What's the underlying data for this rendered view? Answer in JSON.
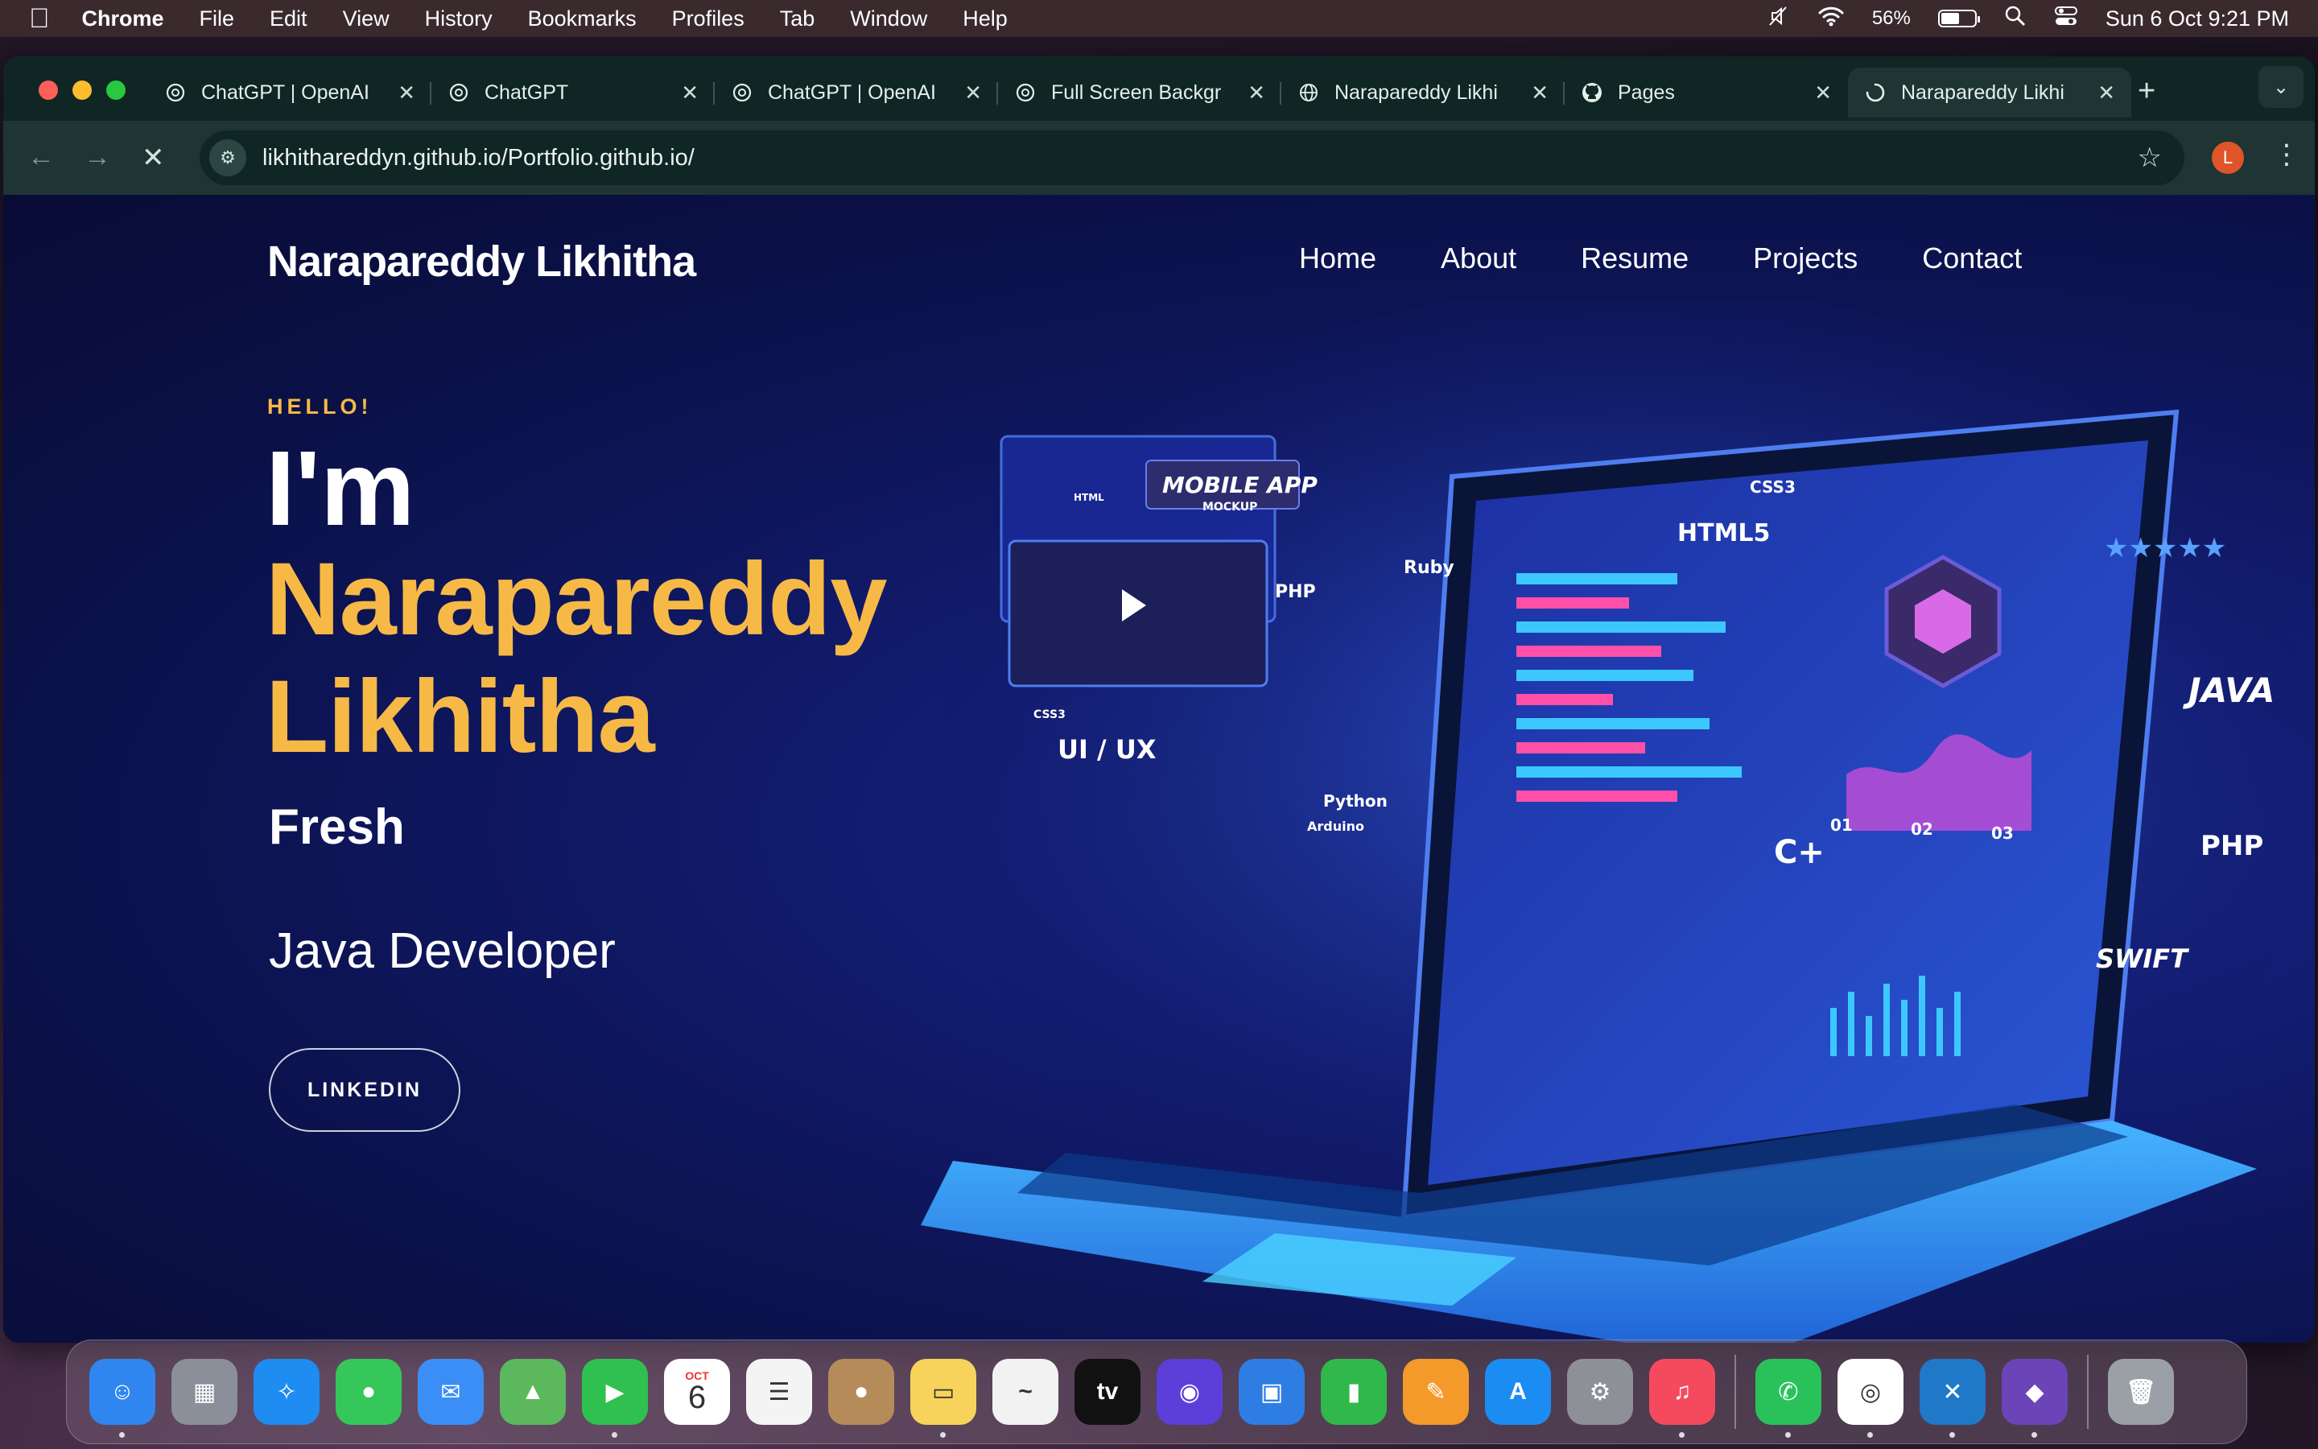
{
  "menubar": {
    "app": "Chrome",
    "items": [
      "File",
      "Edit",
      "View",
      "History",
      "Bookmarks",
      "Profiles",
      "Tab",
      "Window",
      "Help"
    ],
    "battery_pct": "56%",
    "battery_level": 0.56,
    "datetime": "Sun 6 Oct  9:21 PM"
  },
  "tabs": [
    {
      "title": "ChatGPT | OpenAI",
      "icon": "openai-icon",
      "active": false
    },
    {
      "title": "ChatGPT",
      "icon": "openai-icon",
      "active": false
    },
    {
      "title": "ChatGPT | OpenAI",
      "icon": "openai-icon",
      "active": false
    },
    {
      "title": "Full Screen Backgr",
      "icon": "openai-icon",
      "active": false
    },
    {
      "title": "Narapareddy Likhi",
      "icon": "globe-icon",
      "active": false
    },
    {
      "title": "Pages",
      "icon": "github-icon",
      "active": false
    },
    {
      "title": "Narapareddy Likhi",
      "icon": "loading-icon",
      "active": true
    }
  ],
  "address_bar": {
    "url": "likhithareddyn.github.io/Portfolio.github.io/",
    "profile_initial": "L"
  },
  "site": {
    "brand": "Narapareddy Likhitha",
    "nav": [
      "Home",
      "About",
      "Resume",
      "Projects",
      "Contact"
    ],
    "hello": "HELLO!",
    "im": "I'm",
    "name": "Narapareddy Likhitha",
    "fresh": "Fresh",
    "role": "Java Developer",
    "linkedin": "LINKEDIN"
  },
  "hero_art": {
    "labels": [
      "HTML5",
      "CSS3",
      "PHP",
      "Ruby",
      "MOBILE APP",
      "MOCKUP",
      "UI / UX",
      "Python",
      "Arduino",
      "C+",
      "JAVA",
      "PHP",
      "SWIFT",
      "01",
      "02",
      "03",
      "CSS3",
      "HTML"
    ]
  },
  "dock": {
    "apps": [
      {
        "name": "finder",
        "color": "#2f86ef",
        "glyph": "☺",
        "running": true
      },
      {
        "name": "launchpad",
        "color": "#8a8f9a",
        "glyph": "▦",
        "running": false
      },
      {
        "name": "safari",
        "color": "#1e8cf0",
        "glyph": "✧",
        "running": false
      },
      {
        "name": "messages",
        "color": "#35c759",
        "glyph": "●",
        "running": false
      },
      {
        "name": "mail",
        "color": "#3a8ef6",
        "glyph": "✉",
        "running": false
      },
      {
        "name": "maps",
        "color": "#5cb85c",
        "glyph": "▲",
        "running": false
      },
      {
        "name": "facetime",
        "color": "#30c04f",
        "glyph": "▶",
        "running": true
      },
      {
        "name": "calendar",
        "color": "#ffffff",
        "glyph": "6",
        "running": false,
        "month": "OCT",
        "day": "6"
      },
      {
        "name": "reminders",
        "color": "#f4f4f4",
        "glyph": "☰",
        "running": false
      },
      {
        "name": "contacts",
        "color": "#b58b5a",
        "glyph": "●",
        "running": false
      },
      {
        "name": "notes",
        "color": "#f7d35b",
        "glyph": "▭",
        "running": true
      },
      {
        "name": "freeform",
        "color": "#f2f2f2",
        "glyph": "~",
        "running": false
      },
      {
        "name": "apple-tv",
        "color": "#111111",
        "glyph": "tv",
        "running": false
      },
      {
        "name": "siri",
        "color": "#5b3fd8",
        "glyph": "◉",
        "running": false
      },
      {
        "name": "keynote",
        "color": "#2d7de3",
        "glyph": "▣",
        "running": false
      },
      {
        "name": "numbers",
        "color": "#31b84b",
        "glyph": "▮",
        "running": false
      },
      {
        "name": "pages",
        "color": "#f39a2b",
        "glyph": "✎",
        "running": false
      },
      {
        "name": "app-store",
        "color": "#1b8cf1",
        "glyph": "A",
        "running": false
      },
      {
        "name": "system-settings",
        "color": "#8d9096",
        "glyph": "⚙",
        "running": false
      },
      {
        "name": "music",
        "color": "#f54a5e",
        "glyph": "♫",
        "running": true
      },
      {
        "name": "whatsapp",
        "color": "#29c25a",
        "glyph": "✆",
        "running": true
      },
      {
        "name": "chrome",
        "color": "#ffffff",
        "glyph": "◎",
        "running": true
      },
      {
        "name": "vscode",
        "color": "#1f79c8",
        "glyph": "✕",
        "running": true
      },
      {
        "name": "github-desktop",
        "color": "#6b44b8",
        "glyph": "◆",
        "running": true
      },
      {
        "name": "trash",
        "color": "#9aa0a6",
        "glyph": "🗑",
        "running": false
      }
    ]
  },
  "colors": {
    "accent": "#f7b946",
    "page_bg": "#0b1148",
    "tab_strip": "#0f2624"
  }
}
